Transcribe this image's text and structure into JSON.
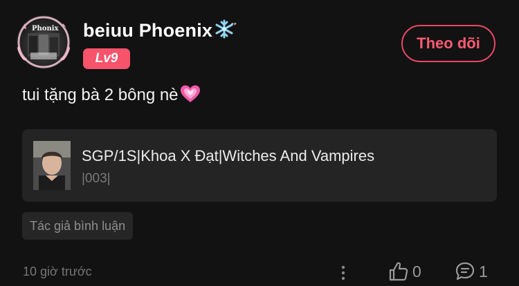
{
  "author": {
    "name": "beiuu Phoenix",
    "name_suffix_icon": "snowflake-icon",
    "avatar_text": "Phonix",
    "level": "Lv9"
  },
  "follow_button": {
    "label": "Theo dõi"
  },
  "post": {
    "text": "tui tặng bà 2 bông nè",
    "emoji_icon": "sparkling-heart-icon"
  },
  "linked_story": {
    "title": "SGP/1S|Khoa X Đạt|Witches And Vampires",
    "subtitle": "|003|"
  },
  "tag": {
    "label": "Tác giả bình luận"
  },
  "footer": {
    "timestamp": "10 giờ trước",
    "like_count": "0",
    "comment_count": "1"
  },
  "colors": {
    "background": "#121212",
    "accent": "#ea4964",
    "level_badge": "#f7536a",
    "card_background": "#242424",
    "muted_text": "#767676"
  }
}
